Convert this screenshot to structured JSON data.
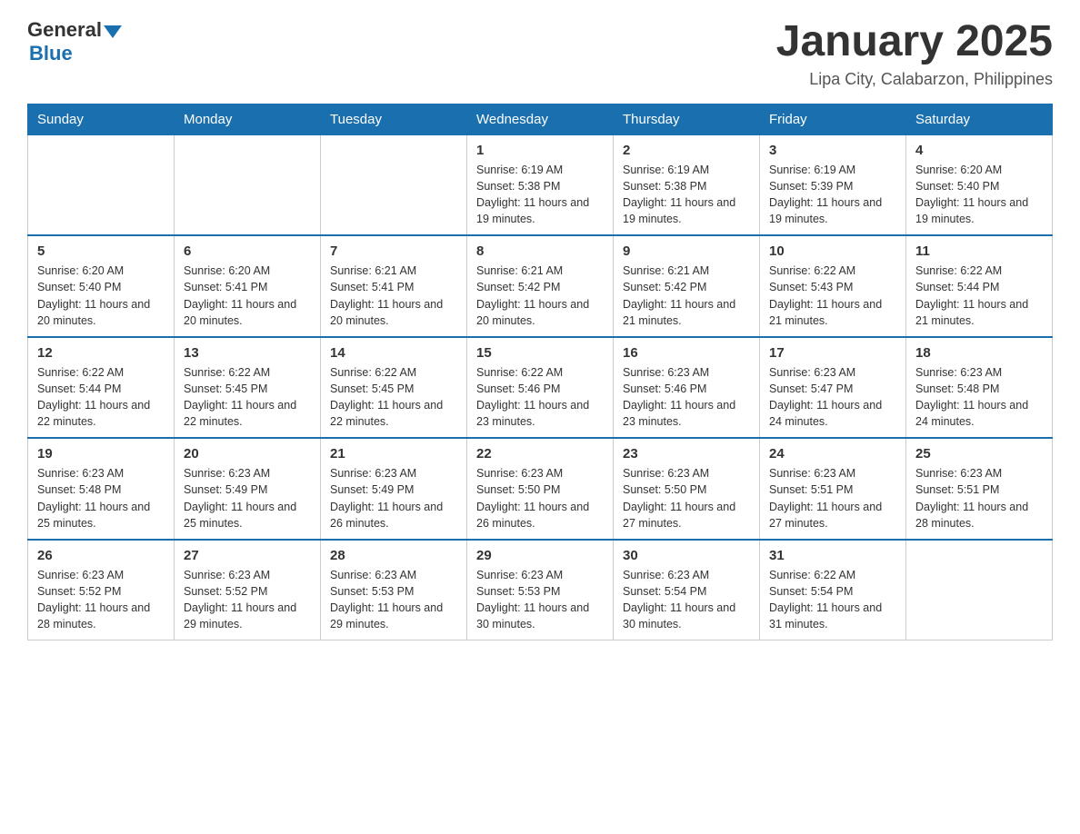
{
  "header": {
    "logo_general": "General",
    "logo_blue": "Blue",
    "month_title": "January 2025",
    "location": "Lipa City, Calabarzon, Philippines"
  },
  "days_of_week": [
    "Sunday",
    "Monday",
    "Tuesday",
    "Wednesday",
    "Thursday",
    "Friday",
    "Saturday"
  ],
  "weeks": [
    {
      "days": [
        {
          "num": "",
          "info": ""
        },
        {
          "num": "",
          "info": ""
        },
        {
          "num": "",
          "info": ""
        },
        {
          "num": "1",
          "info": "Sunrise: 6:19 AM\nSunset: 5:38 PM\nDaylight: 11 hours and 19 minutes."
        },
        {
          "num": "2",
          "info": "Sunrise: 6:19 AM\nSunset: 5:38 PM\nDaylight: 11 hours and 19 minutes."
        },
        {
          "num": "3",
          "info": "Sunrise: 6:19 AM\nSunset: 5:39 PM\nDaylight: 11 hours and 19 minutes."
        },
        {
          "num": "4",
          "info": "Sunrise: 6:20 AM\nSunset: 5:40 PM\nDaylight: 11 hours and 19 minutes."
        }
      ]
    },
    {
      "days": [
        {
          "num": "5",
          "info": "Sunrise: 6:20 AM\nSunset: 5:40 PM\nDaylight: 11 hours and 20 minutes."
        },
        {
          "num": "6",
          "info": "Sunrise: 6:20 AM\nSunset: 5:41 PM\nDaylight: 11 hours and 20 minutes."
        },
        {
          "num": "7",
          "info": "Sunrise: 6:21 AM\nSunset: 5:41 PM\nDaylight: 11 hours and 20 minutes."
        },
        {
          "num": "8",
          "info": "Sunrise: 6:21 AM\nSunset: 5:42 PM\nDaylight: 11 hours and 20 minutes."
        },
        {
          "num": "9",
          "info": "Sunrise: 6:21 AM\nSunset: 5:42 PM\nDaylight: 11 hours and 21 minutes."
        },
        {
          "num": "10",
          "info": "Sunrise: 6:22 AM\nSunset: 5:43 PM\nDaylight: 11 hours and 21 minutes."
        },
        {
          "num": "11",
          "info": "Sunrise: 6:22 AM\nSunset: 5:44 PM\nDaylight: 11 hours and 21 minutes."
        }
      ]
    },
    {
      "days": [
        {
          "num": "12",
          "info": "Sunrise: 6:22 AM\nSunset: 5:44 PM\nDaylight: 11 hours and 22 minutes."
        },
        {
          "num": "13",
          "info": "Sunrise: 6:22 AM\nSunset: 5:45 PM\nDaylight: 11 hours and 22 minutes."
        },
        {
          "num": "14",
          "info": "Sunrise: 6:22 AM\nSunset: 5:45 PM\nDaylight: 11 hours and 22 minutes."
        },
        {
          "num": "15",
          "info": "Sunrise: 6:22 AM\nSunset: 5:46 PM\nDaylight: 11 hours and 23 minutes."
        },
        {
          "num": "16",
          "info": "Sunrise: 6:23 AM\nSunset: 5:46 PM\nDaylight: 11 hours and 23 minutes."
        },
        {
          "num": "17",
          "info": "Sunrise: 6:23 AM\nSunset: 5:47 PM\nDaylight: 11 hours and 24 minutes."
        },
        {
          "num": "18",
          "info": "Sunrise: 6:23 AM\nSunset: 5:48 PM\nDaylight: 11 hours and 24 minutes."
        }
      ]
    },
    {
      "days": [
        {
          "num": "19",
          "info": "Sunrise: 6:23 AM\nSunset: 5:48 PM\nDaylight: 11 hours and 25 minutes."
        },
        {
          "num": "20",
          "info": "Sunrise: 6:23 AM\nSunset: 5:49 PM\nDaylight: 11 hours and 25 minutes."
        },
        {
          "num": "21",
          "info": "Sunrise: 6:23 AM\nSunset: 5:49 PM\nDaylight: 11 hours and 26 minutes."
        },
        {
          "num": "22",
          "info": "Sunrise: 6:23 AM\nSunset: 5:50 PM\nDaylight: 11 hours and 26 minutes."
        },
        {
          "num": "23",
          "info": "Sunrise: 6:23 AM\nSunset: 5:50 PM\nDaylight: 11 hours and 27 minutes."
        },
        {
          "num": "24",
          "info": "Sunrise: 6:23 AM\nSunset: 5:51 PM\nDaylight: 11 hours and 27 minutes."
        },
        {
          "num": "25",
          "info": "Sunrise: 6:23 AM\nSunset: 5:51 PM\nDaylight: 11 hours and 28 minutes."
        }
      ]
    },
    {
      "days": [
        {
          "num": "26",
          "info": "Sunrise: 6:23 AM\nSunset: 5:52 PM\nDaylight: 11 hours and 28 minutes."
        },
        {
          "num": "27",
          "info": "Sunrise: 6:23 AM\nSunset: 5:52 PM\nDaylight: 11 hours and 29 minutes."
        },
        {
          "num": "28",
          "info": "Sunrise: 6:23 AM\nSunset: 5:53 PM\nDaylight: 11 hours and 29 minutes."
        },
        {
          "num": "29",
          "info": "Sunrise: 6:23 AM\nSunset: 5:53 PM\nDaylight: 11 hours and 30 minutes."
        },
        {
          "num": "30",
          "info": "Sunrise: 6:23 AM\nSunset: 5:54 PM\nDaylight: 11 hours and 30 minutes."
        },
        {
          "num": "31",
          "info": "Sunrise: 6:22 AM\nSunset: 5:54 PM\nDaylight: 11 hours and 31 minutes."
        },
        {
          "num": "",
          "info": ""
        }
      ]
    }
  ]
}
